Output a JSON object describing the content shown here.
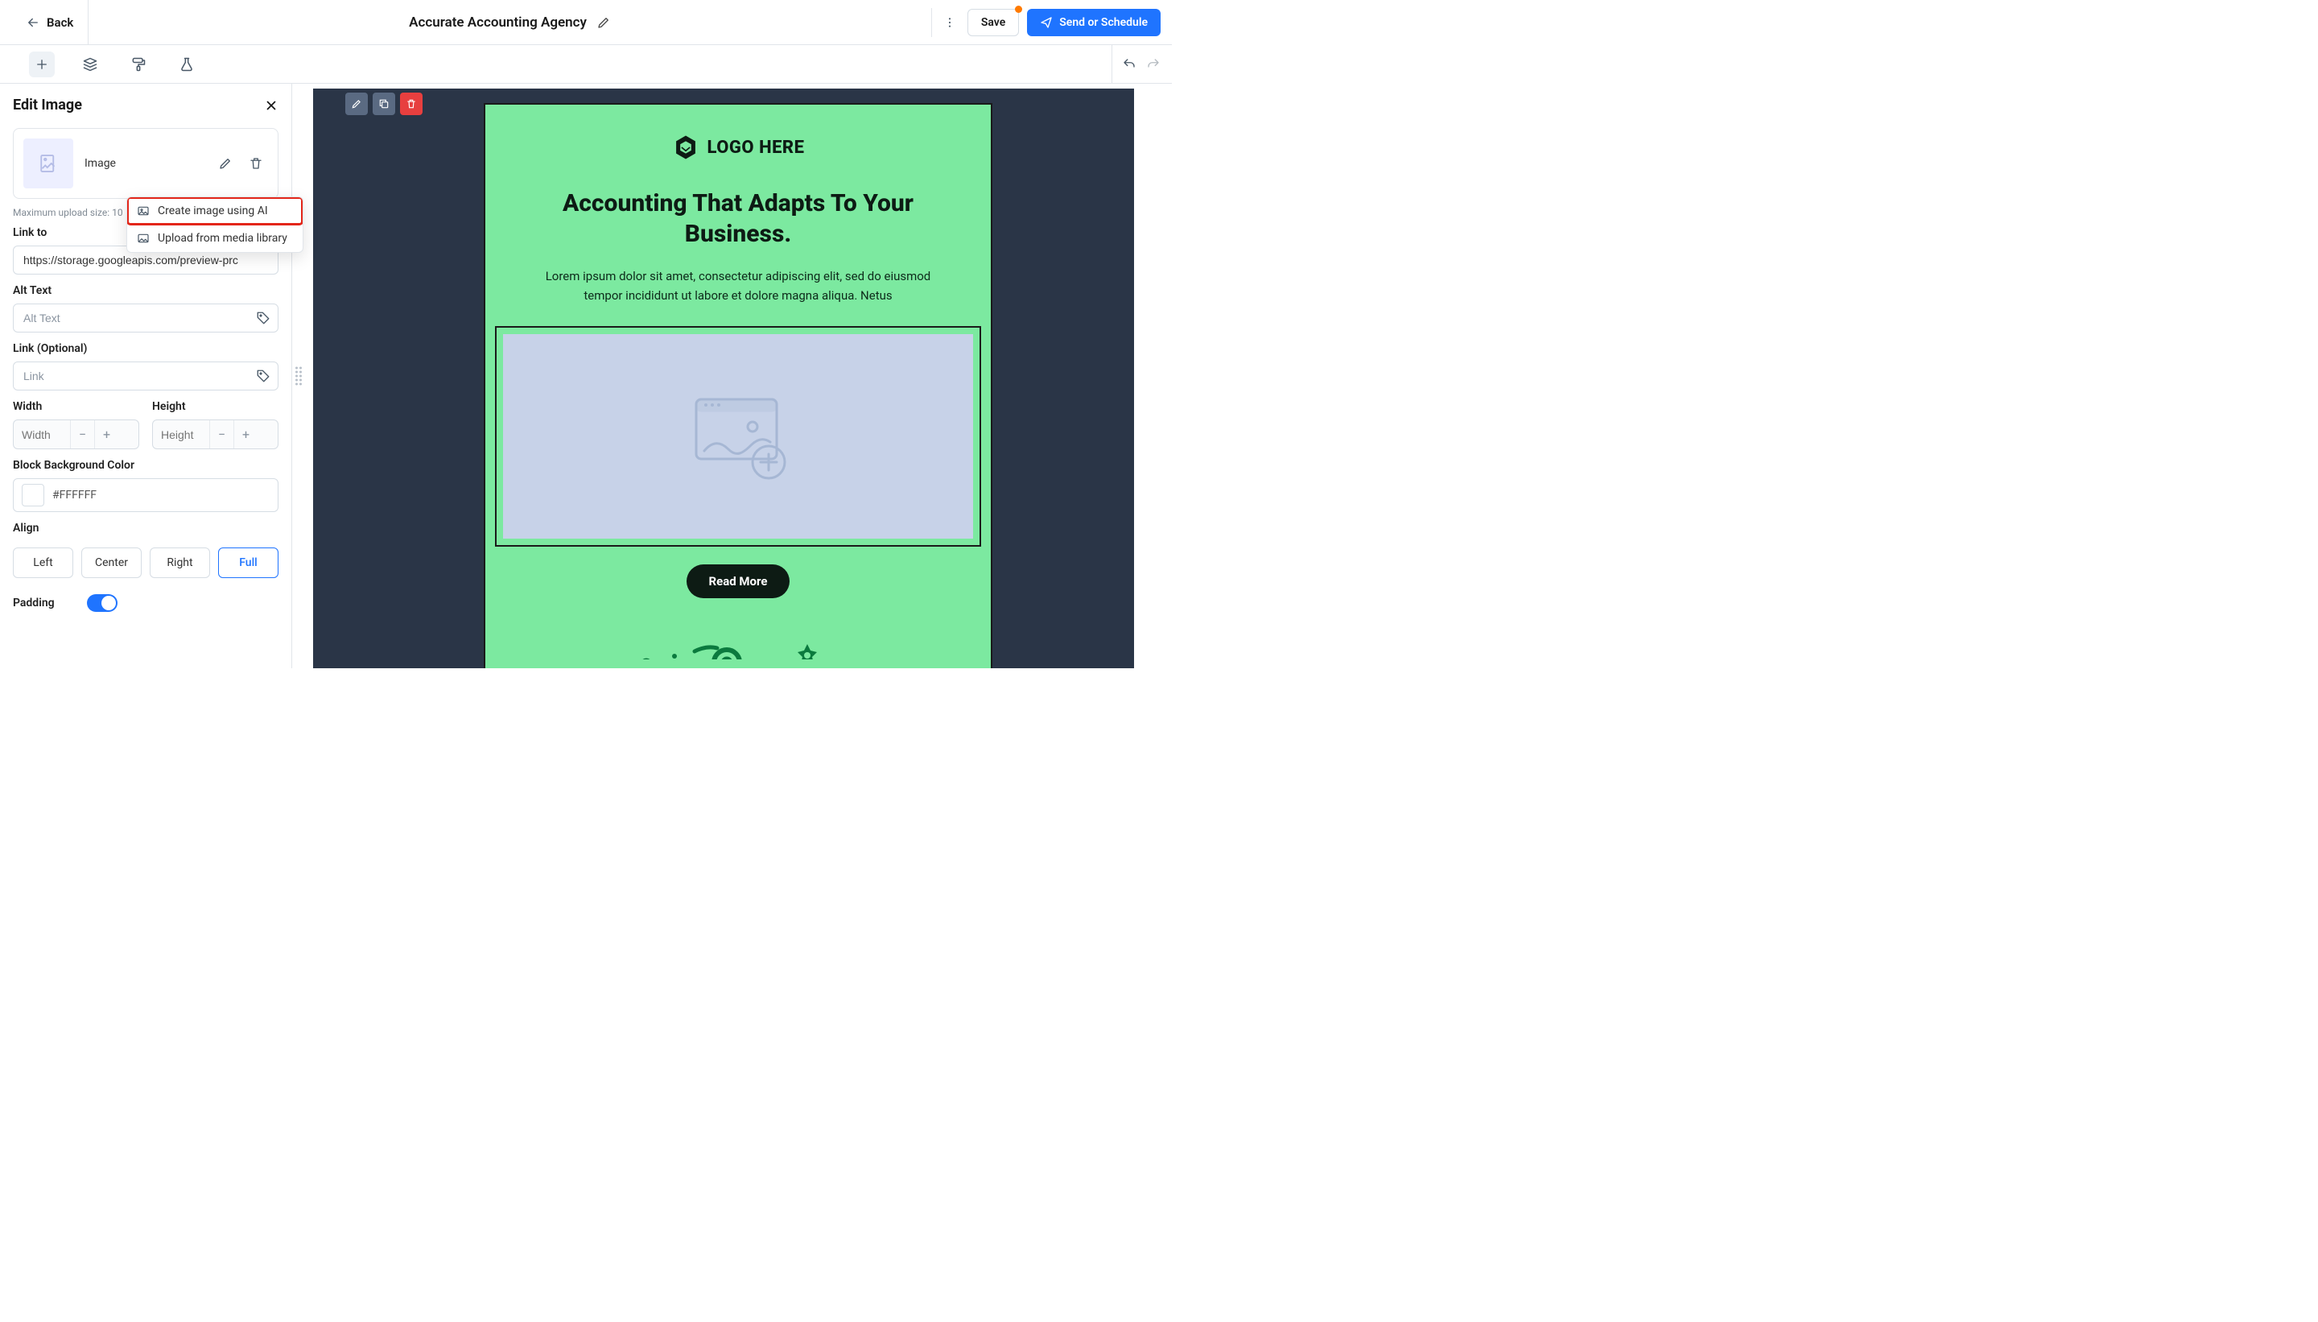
{
  "topbar": {
    "back_label": "Back",
    "title": "Accurate Accounting Agency",
    "save_label": "Save",
    "send_label": "Send or Schedule"
  },
  "panel": {
    "title": "Edit Image",
    "image_label": "Image",
    "max_upload": "Maximum upload size: 10",
    "link_to_label": "Link to",
    "link_to_value": "https://storage.googleapis.com/preview-prc",
    "alt_text_label": "Alt Text",
    "alt_text_placeholder": "Alt Text",
    "link_label": "Link (Optional)",
    "link_placeholder": "Link",
    "width_label": "Width",
    "width_placeholder": "Width",
    "height_label": "Height",
    "height_placeholder": "Height",
    "bg_label": "Block Background Color",
    "bg_value": "#FFFFFF",
    "align_label": "Align",
    "align_options": {
      "left": "Left",
      "center": "Center",
      "right": "Right",
      "full": "Full"
    },
    "padding_label": "Padding"
  },
  "dropdown": {
    "item_ai": "Create image using AI",
    "item_upload": "Upload from media library"
  },
  "email": {
    "logo_text": "LOGO HERE",
    "headline_1": "Accounting That Adapts To Your",
    "headline_2": "Business.",
    "body": "Lorem ipsum dolor sit amet, consectetur adipiscing elit, sed do eiusmod tempor incididunt ut labore et dolore magna aliqua. Netus",
    "read_more": "Read More"
  }
}
